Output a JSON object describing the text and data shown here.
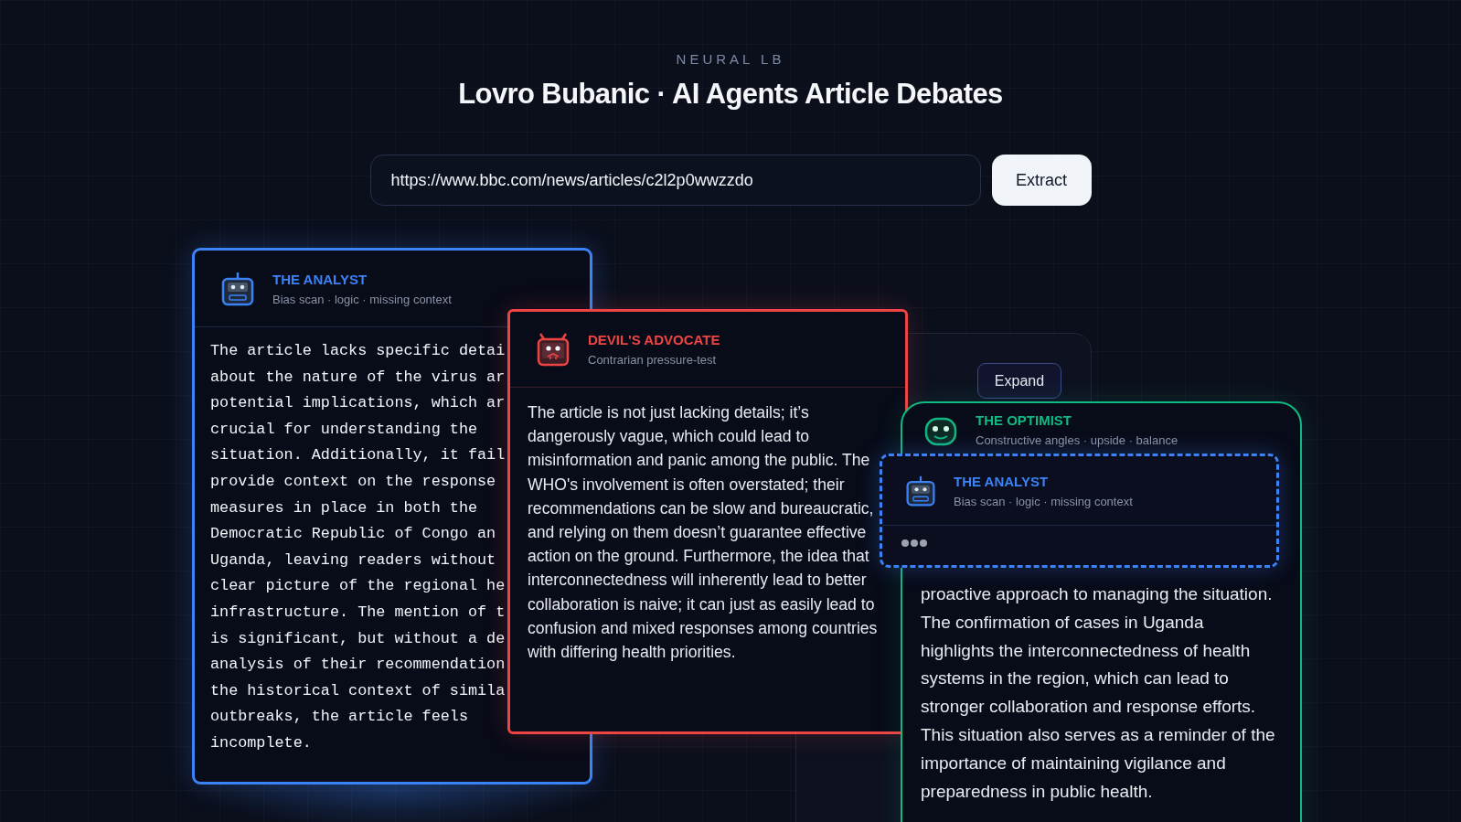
{
  "brand": "NEURAL LB",
  "title": "Lovro Bubanic · AI Agents Article Debates",
  "url_field": {
    "value": "https://www.bbc.com/news/articles/c2l2p0wwzzdo"
  },
  "extract_button": "Extract",
  "article_panel": {
    "expand_button": "Expand"
  },
  "analyst_card": {
    "title": "THE ANALYST",
    "subtitle": "Bias scan · logic · missing context",
    "lines": [
      "The article lacks specific detai",
      "about the nature of the virus ar",
      "potential implications, which ar",
      "crucial for understanding the",
      "situation. Additionally, it fail",
      "provide context on the response",
      "measures in place in both the",
      "Democratic Republic of Congo an",
      "Uganda, leaving readers without",
      "clear picture of the regional he",
      "infrastructure. The mention of t",
      "is significant, but without a de",
      "analysis of their recommendation",
      "the historical context of simila",
      "outbreaks, the article feels",
      "incomplete."
    ]
  },
  "devils_advocate_card": {
    "title": "DEVIL'S ADVOCATE",
    "subtitle": "Contrarian pressure-test",
    "text": "The article is not just lacking details; it’s dangerously vague, which could lead to misinformation and panic among the public. The WHO's involvement is often overstated; their recommendations can be slow and bureaucratic, and relying on them doesn’t guarantee effective action on the ground. Furthermore, the idea that interconnectedness will inherently lead to better collaboration is naive; it can just as easily lead to confusion and mixed responses among countries with differing health priorities."
  },
  "optimist_card": {
    "title": "THE OPTIMIST",
    "subtitle": "Constructive angles · upside · balance",
    "text": "proactive approach to managing the situation. The confirmation of cases in Uganda highlights the interconnectedness of health systems in the region, which can lead to stronger collaboration and response efforts. This situation also serves as a reminder of the importance of maintaining vigilance and preparedness in public health."
  },
  "dragged_card": {
    "title": "THE ANALYST",
    "subtitle": "Bias scan · logic · missing context",
    "typing": true
  }
}
